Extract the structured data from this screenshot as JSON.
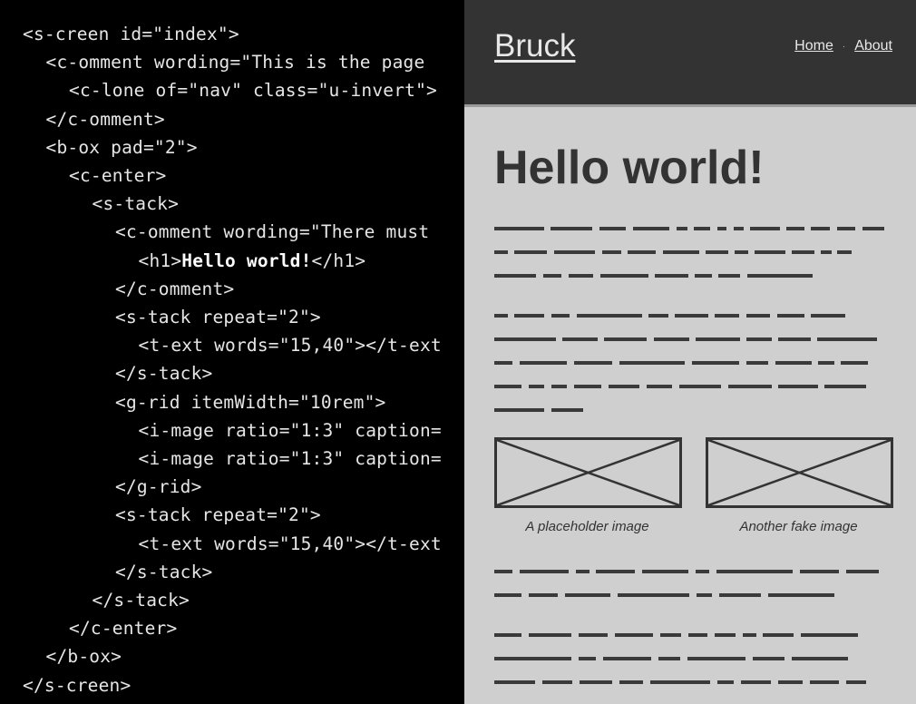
{
  "code": {
    "lines": [
      {
        "indent": 0,
        "text": "<s-creen id=\"index\">"
      },
      {
        "indent": 1,
        "text": "<c-omment wording=\"This is the page"
      },
      {
        "indent": 2,
        "text": "<c-lone of=\"nav\" class=\"u-invert\">"
      },
      {
        "indent": 1,
        "text": "</c-omment>"
      },
      {
        "indent": 1,
        "text": "<b-ox pad=\"2\">"
      },
      {
        "indent": 2,
        "text": "<c-enter>"
      },
      {
        "indent": 3,
        "text": "<s-tack>"
      },
      {
        "indent": 4,
        "text": "<c-omment wording=\"There must"
      },
      {
        "indent": 5,
        "text": "<h1>Hello world!</h1>",
        "strong": "Hello world!"
      },
      {
        "indent": 4,
        "text": "</c-omment>"
      },
      {
        "indent": 4,
        "text": "<s-tack repeat=\"2\">"
      },
      {
        "indent": 5,
        "text": "<t-ext words=\"15,40\"></t-ext"
      },
      {
        "indent": 4,
        "text": "</s-tack>"
      },
      {
        "indent": 4,
        "text": "<g-rid itemWidth=\"10rem\">"
      },
      {
        "indent": 5,
        "text": "<i-mage ratio=\"1:3\" caption="
      },
      {
        "indent": 5,
        "text": "<i-mage ratio=\"1:3\" caption="
      },
      {
        "indent": 4,
        "text": "</g-rid>"
      },
      {
        "indent": 4,
        "text": "<s-tack repeat=\"2\">"
      },
      {
        "indent": 5,
        "text": "<t-ext words=\"15,40\"></t-ext"
      },
      {
        "indent": 4,
        "text": "</s-tack>"
      },
      {
        "indent": 3,
        "text": "</s-tack>"
      },
      {
        "indent": 2,
        "text": "</c-enter>"
      },
      {
        "indent": 1,
        "text": "</b-ox>"
      },
      {
        "indent": 0,
        "text": "</s-creen>"
      }
    ]
  },
  "preview": {
    "brand": "Bruck",
    "nav": {
      "home": "Home",
      "separator": "·",
      "about": "About"
    },
    "title": "Hello world!",
    "images": [
      {
        "caption": "A placeholder image"
      },
      {
        "caption": "Another fake image"
      }
    ]
  },
  "colors": {
    "code_bg": "#000000",
    "code_text": "#e6e6e6",
    "header_bg": "#333333",
    "page_bg": "#cfcfcf",
    "ink": "#333333"
  }
}
